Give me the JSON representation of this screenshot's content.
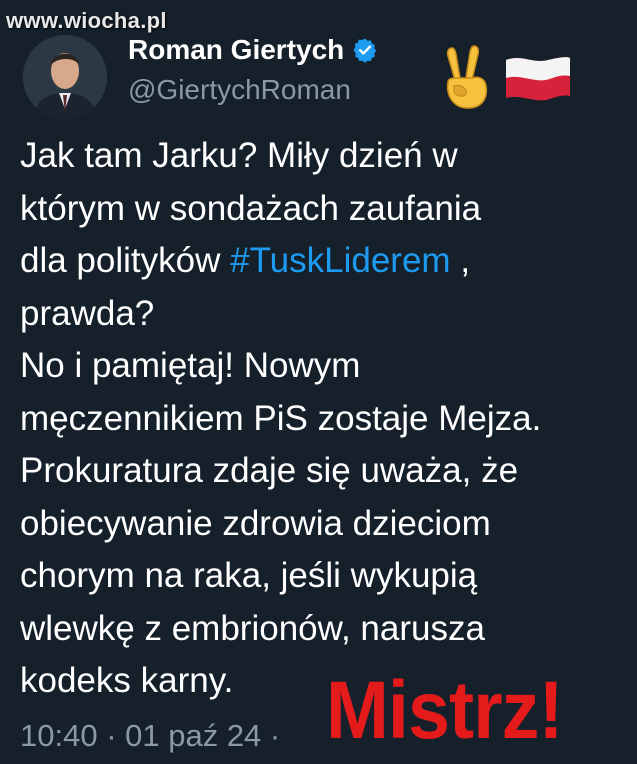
{
  "watermark": {
    "text": "www.wiocha.pl"
  },
  "author": {
    "name": "Roman Giertych",
    "handle": "@GiertychRoman",
    "verified_icon": "verified-badge-icon",
    "header_emojis": [
      "victory-hand-icon",
      "poland-flag-icon"
    ]
  },
  "tweet": {
    "lines": [
      "Jak tam Jarku? Miły dzień w",
      "którym w sondażach zaufania",
      "dla polityków",
      "prawda?",
      "No i pamiętaj! Nowym",
      "męczennikiem PiS zostaje Mejza.",
      "Prokuratura zdaje się uważa, że",
      "obiecywanie zdrowia dzieciom",
      "chorym na raka, jeśli wykupią",
      "wlewkę z embrionów,  narusza",
      "kodeks karny."
    ],
    "hashtag": "#TuskLiderem",
    "hashtag_suffix": " ,",
    "timestamp": "10:40 · 01 paź 24 ·"
  },
  "overlay": {
    "stamp_text": "Mistrz!"
  },
  "colors": {
    "background": "#15202b",
    "text": "#ffffff",
    "secondary": "#8b98a5",
    "link": "#1d9bf0",
    "stamp": "#e51a1a"
  }
}
